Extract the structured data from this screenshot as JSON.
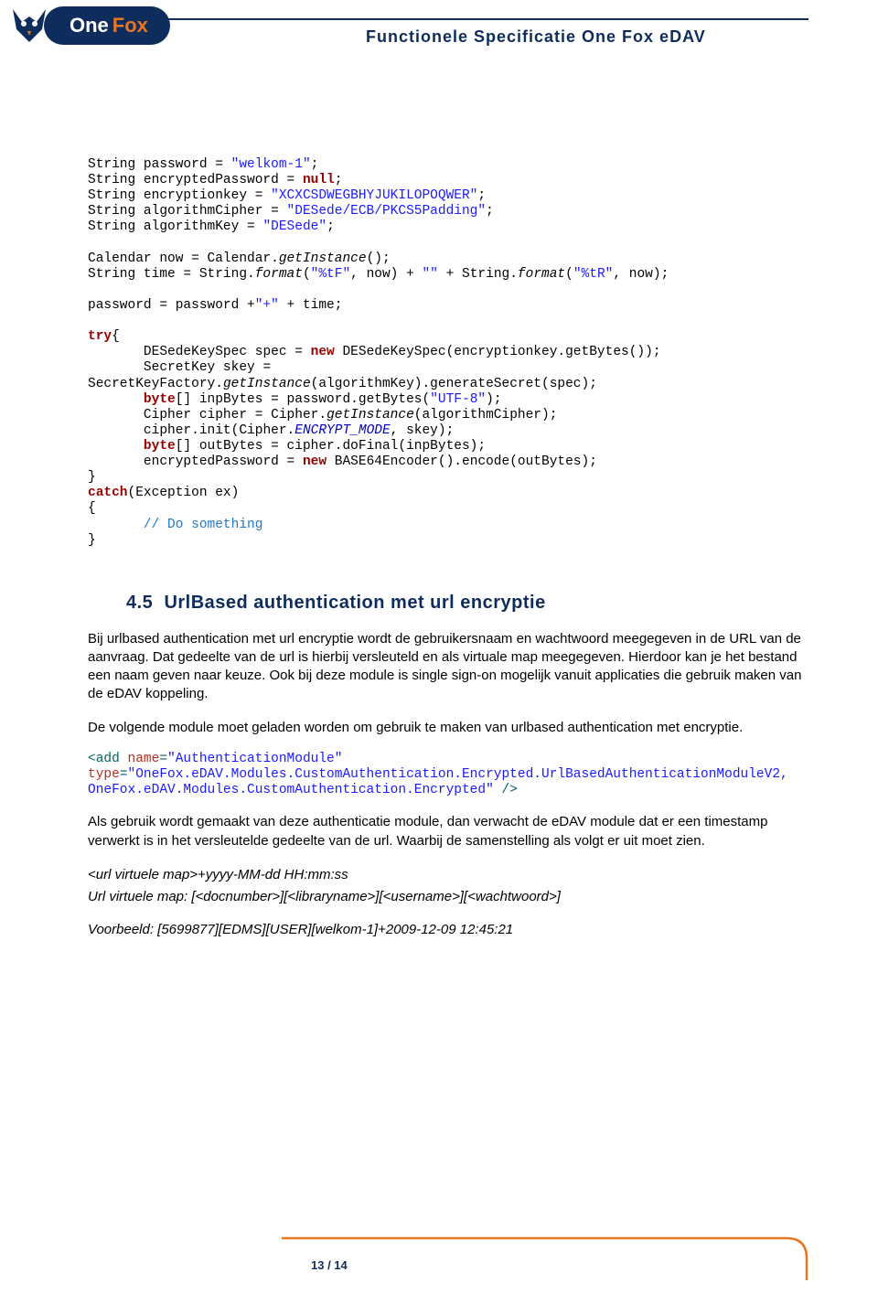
{
  "header": {
    "logo_text_1": "One",
    "logo_text_2": "Fox",
    "doc_title": "Functionele Specificatie One Fox eDAV"
  },
  "code": {
    "l1a": "String password = ",
    "l1b": "\"welkom-1\"",
    "l1c": ";",
    "l2a": "String encryptedPassword = ",
    "l2b": "null",
    "l2c": ";",
    "l3a": "String encryptionkey = ",
    "l3b": "\"XCXCSDWEGBHYJUKILOPOQWER\"",
    "l3c": ";",
    "l4a": "String algorithmCipher = ",
    "l4b": "\"DESede/ECB/PKCS5Padding\"",
    "l4c": ";",
    "l5a": "String algorithmKey = ",
    "l5b": "\"DESede\"",
    "l5c": ";",
    "l7a": "Calendar now = Calendar.",
    "l7b": "getInstance",
    "l7c": "();",
    "l8a": "String time = String.",
    "l8b": "format",
    "l8c": "(",
    "l8d": "\"%tF\"",
    "l8e": ", now) + ",
    "l8f": "\"\"",
    "l8g": " + String.",
    "l8h": "format",
    "l8i": "(",
    "l8j": "\"%tR\"",
    "l8k": ", now);",
    "l10a": "password = password +",
    "l10b": "\"+\"",
    "l10c": " + time;",
    "l12": "try",
    "l12b": "{",
    "l13a": "       DESedeKeySpec spec = ",
    "l13b": "new",
    "l13c": " DESedeKeySpec(encryptionkey.getBytes());",
    "l14": "       SecretKey skey =",
    "l15a": "SecretKeyFactory.",
    "l15b": "getInstance",
    "l15c": "(algorithmKey).generateSecret(spec);",
    "l16a": "       ",
    "l16b": "byte",
    "l16c": "[] inpBytes = password.getBytes(",
    "l16d": "\"UTF-8\"",
    "l16e": ");",
    "l17a": "       Cipher cipher = Cipher.",
    "l17b": "getInstance",
    "l17c": "(algorithmCipher);",
    "l18a": "       cipher.init(Cipher.",
    "l18b": "ENCRYPT_MODE",
    "l18c": ", skey);",
    "l19a": "       ",
    "l19b": "byte",
    "l19c": "[] outBytes = cipher.doFinal(inpBytes);",
    "l20a": "       encryptedPassword = ",
    "l20b": "new",
    "l20c": " BASE64Encoder().encode(outBytes);",
    "l21": "}",
    "l22a": "catch",
    "l22b": "(Exception ex)",
    "l23": "{",
    "l24": "       // Do something",
    "l25": "}"
  },
  "section": {
    "num": "4.5",
    "title": "UrlBased authentication met url encryptie"
  },
  "p1": "Bij urlbased authentication met url encryptie wordt de gebruikersnaam en wachtwoord meegegeven in de URL van de aanvraag. Dat gedeelte van de url is hierbij versleuteld en als virtuale map meegegeven. Hierdoor kan je het bestand een naam geven naar keuze. Ook bij deze module is single sign-on mogelijk vanuit applicaties die gebruik maken van de eDAV koppeling.",
  "p2": "De volgende module moet geladen worden om gebruik te maken van urlbased authentication met encryptie.",
  "xml": {
    "l1a": "<",
    "l1b": "add",
    "l1c": " ",
    "l1d": "name",
    "l1e": "=",
    "l1f": "\"AuthenticationModule\"",
    "l2a": "type",
    "l2b": "=",
    "l2c": "\"OneFox.eDAV.Modules.CustomAuthentication.Encrypted.UrlBasedAuthenticationModuleV2, OneFox.eDAV.Modules.CustomAuthentication.Encrypted\"",
    "l2d": " />"
  },
  "p3": "Als gebruik wordt gemaakt van deze authenticatie module, dan verwacht de eDAV module dat er een timestamp verwerkt is in het versleutelde gedeelte van de url. Waarbij de samenstelling als volgt er uit moet zien.",
  "spec1": "<url virtuele map>+yyyy-MM-dd HH:mm:ss",
  "spec2": "Url virtuele map: [<docnumber>][<libraryname>][<username>][<wachtwoord>]",
  "spec3": "Voorbeeld: [5699877][EDMS][USER][welkom-1]+2009-12-09 12:45:21",
  "footer": {
    "page": "13 / 14"
  }
}
